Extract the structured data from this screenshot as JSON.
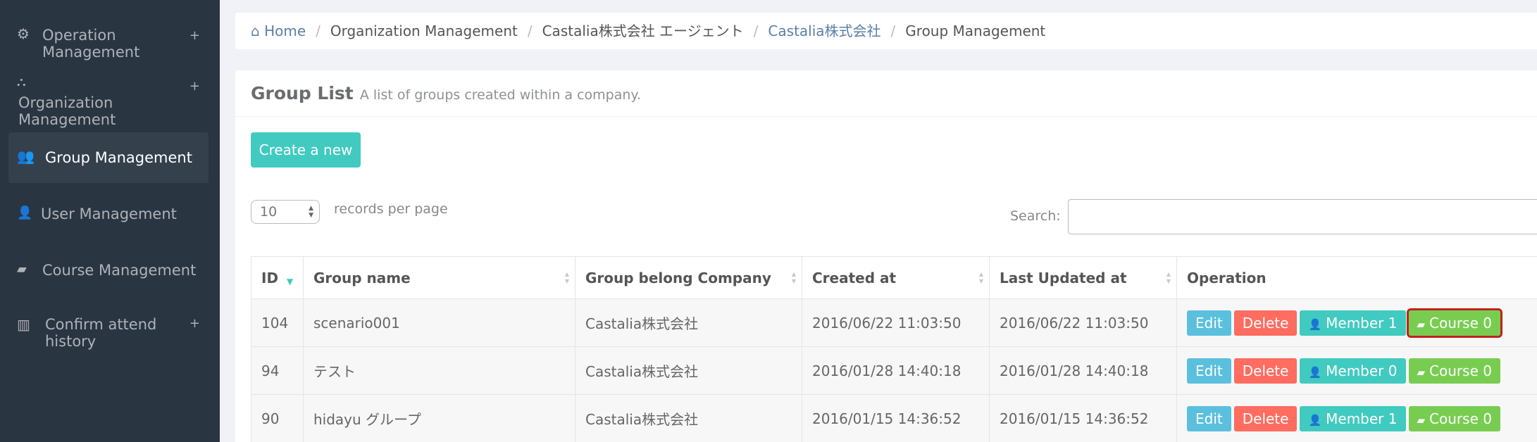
{
  "sidebar": {
    "items": [
      {
        "label": "Operation Management",
        "icon": "gear-icon",
        "glyph": "⚙",
        "plus": "+"
      },
      {
        "label": "Organization Management",
        "icon": "sitemap-icon",
        "glyph": "⛬",
        "plus": "+"
      },
      {
        "label": "Group Management",
        "icon": "users-icon",
        "glyph": "👥",
        "active": true
      },
      {
        "label": "User Management",
        "icon": "user-icon",
        "glyph": "👤"
      },
      {
        "label": "Course Management",
        "icon": "book-icon",
        "glyph": "▰"
      },
      {
        "label": "Confirm attend history",
        "icon": "bar-chart-icon",
        "glyph": "▥",
        "plus": "+"
      }
    ]
  },
  "breadcrumb": {
    "home_icon": "⌂",
    "home": "Home",
    "items": [
      "Organization Management",
      "Castalia株式会社 エージェント",
      "Castalia株式会社",
      "Group Management"
    ],
    "sep": "/"
  },
  "panel": {
    "title": "Group List",
    "subtitle": "A list of groups created within a company.",
    "create_label": "Create a new",
    "per_page_value": "10",
    "per_page_label": "records per page",
    "search_label": "Search:",
    "search_value": ""
  },
  "table": {
    "headers": [
      "ID",
      "Group name",
      "Group belong Company",
      "Created at",
      "Last Updated at",
      "Operation"
    ],
    "rows": [
      {
        "id": "104",
        "name": "scenario001",
        "company": "Castalia株式会社",
        "created": "2016/06/22 11:03:50",
        "updated": "2016/06/22 11:03:50",
        "edit": "Edit",
        "delete": "Delete",
        "member": "Member 1",
        "course": "Course 0"
      },
      {
        "id": "94",
        "name": "テスト",
        "company": "Castalia株式会社",
        "created": "2016/01/28 14:40:18",
        "updated": "2016/01/28 14:40:18",
        "edit": "Edit",
        "delete": "Delete",
        "member": "Member 0",
        "course": "Course 0"
      },
      {
        "id": "90",
        "name": "hidayu グループ",
        "company": "Castalia株式会社",
        "created": "2016/01/15 14:36:52",
        "updated": "2016/01/15 14:36:52",
        "edit": "Edit",
        "delete": "Delete",
        "member": "Member 1",
        "course": "Course 0"
      }
    ]
  },
  "colors": {
    "sidebar_bg": "#2a3542",
    "accent": "#41cac0",
    "edit": "#5bc0de",
    "delete": "#ff6c60",
    "course": "#78cd51",
    "focus_outline": "#c0221b",
    "group_icon": "#ff6c60"
  }
}
